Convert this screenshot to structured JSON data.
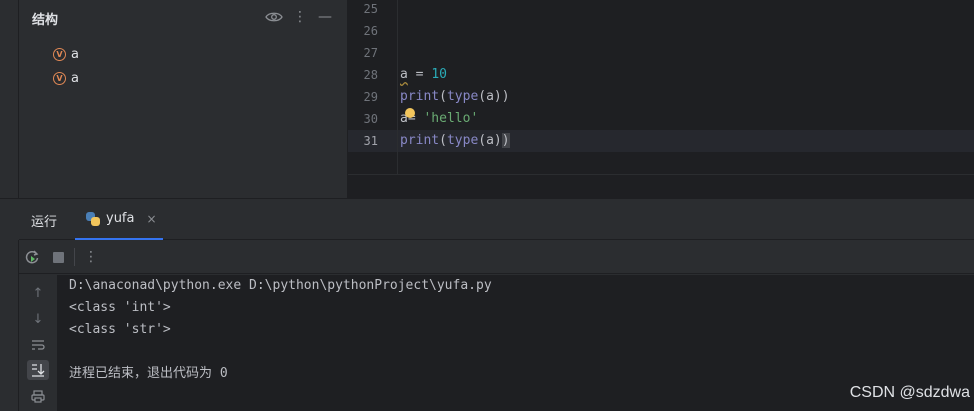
{
  "structure": {
    "title": "结构",
    "items": [
      {
        "icon": "variable-icon",
        "badge": "V",
        "label": "a"
      },
      {
        "icon": "variable-icon",
        "badge": "V",
        "label": "a"
      }
    ]
  },
  "editor": {
    "line_numbers": [
      "25",
      "26",
      "27",
      "28",
      "29",
      "30",
      "31"
    ],
    "current_line": "31",
    "code": {
      "l28": {
        "a": "a",
        "eq": " = ",
        "num": "10"
      },
      "l29": {
        "fn1": "print",
        "p1": "(",
        "fn2": "type",
        "rest": "(a))"
      },
      "l30": {
        "a": "a",
        "eq": "= ",
        "str": "'hello'"
      },
      "l31": {
        "fn1": "print",
        "p1": "(",
        "fn2": "type",
        "mid": "(a)",
        "last": ")"
      }
    }
  },
  "run_panel": {
    "title": "运行",
    "tab_label": "yufa",
    "close_glyph": "×"
  },
  "console": {
    "lines": [
      "D:\\anaconad\\python.exe D:\\python\\pythonProject\\yufa.py",
      "<class 'int'>",
      "<class 'str'>",
      "",
      "进程已结束，退出代码为 0"
    ]
  },
  "watermark": "CSDN @sdzdwa",
  "colors": {
    "accent": "#3574f0",
    "number": "#2aacb8",
    "string": "#6aab73",
    "function": "#8888c6",
    "variable_badge": "#e08855"
  }
}
